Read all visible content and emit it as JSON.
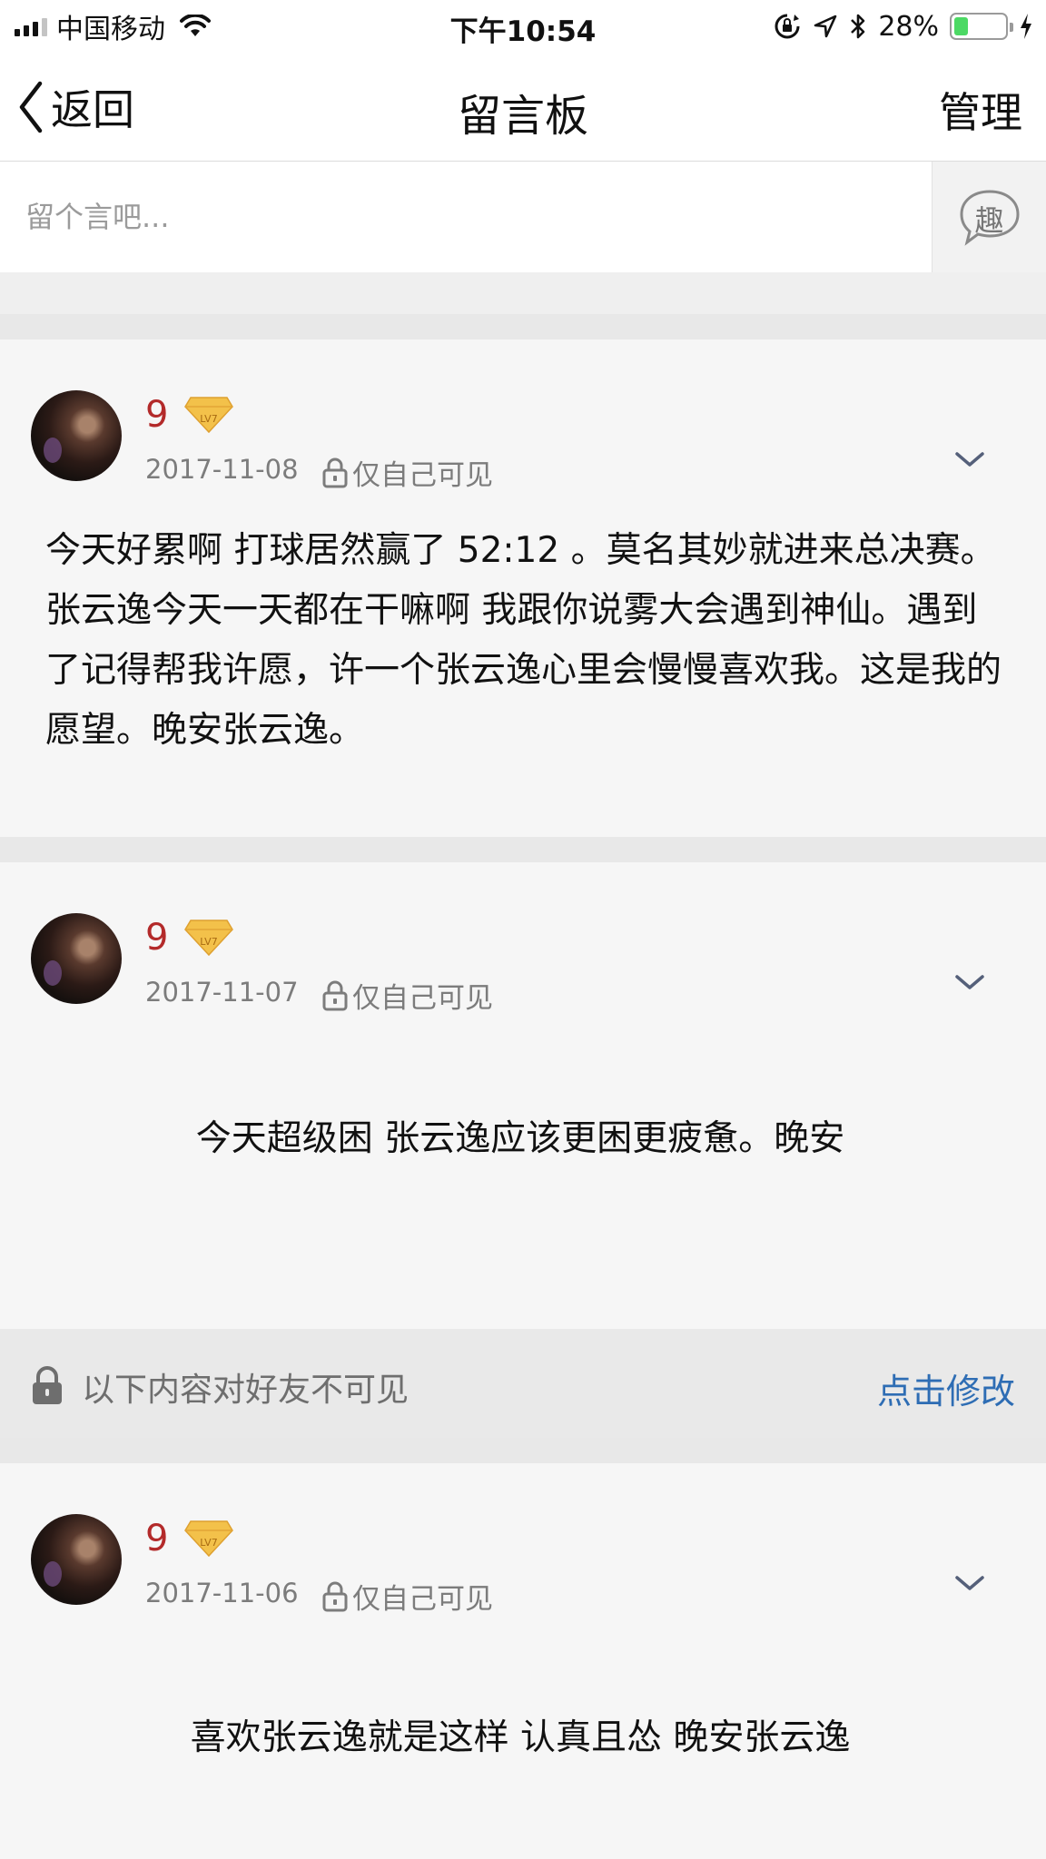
{
  "status_bar": {
    "carrier": "中国移动",
    "time": "下午10:54",
    "battery_percent": "28%",
    "battery_level": 0.28,
    "icons": [
      "signal-bars-icon",
      "wifi-icon",
      "rotation-lock-icon",
      "location-arrow-icon",
      "bluetooth-icon",
      "battery-icon",
      "charging-bolt-icon"
    ]
  },
  "nav": {
    "back_label": "返回",
    "title": "留言板",
    "manage_label": "管理"
  },
  "composer": {
    "placeholder": "留个言吧...",
    "fun_button_label": "趣"
  },
  "posts": [
    {
      "author": "9",
      "level": "LV7",
      "date": "2017-11-08",
      "visibility": "仅自己可见",
      "text": "今天好累啊 打球居然赢了 52:12 。莫名其妙就进来总决赛。张云逸今天一天都在干嘛啊 我跟你说雾大会遇到神仙。遇到了记得帮我许愿，许一个张云逸心里会慢慢喜欢我。这是我的愿望。晚安张云逸。"
    },
    {
      "author": "9",
      "level": "LV7",
      "date": "2017-11-07",
      "visibility": "仅自己可见",
      "text": "今天超级困 张云逸应该更困更疲惫。晚安"
    },
    {
      "author": "9",
      "level": "LV7",
      "date": "2017-11-06",
      "visibility": "仅自己可见",
      "text": "喜欢张云逸就是这样 认真且怂 晚安张云逸"
    }
  ],
  "privacy_notice": {
    "text": "以下内容对好友不可见",
    "action_label": "点击修改"
  },
  "colors": {
    "author_name": "#b32a2a",
    "link": "#2e6db4",
    "battery": "#4cd964",
    "badge_gold": "#f3c14a"
  }
}
